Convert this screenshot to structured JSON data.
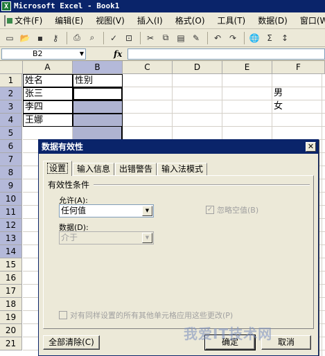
{
  "window": {
    "title": "Microsoft Excel - Book1"
  },
  "menu": [
    "文件(F)",
    "编辑(E)",
    "视图(V)",
    "插入(I)",
    "格式(O)",
    "工具(T)",
    "数据(D)",
    "窗口(W)"
  ],
  "toolbar": {
    "icons": [
      "new-icon",
      "open-icon",
      "save-icon",
      "permission-icon",
      "print-icon",
      "print-preview-icon",
      "spelling-icon",
      "research-icon",
      "cut-icon",
      "copy-icon",
      "paste-icon",
      "format-painter-icon",
      "undo-icon",
      "redo-icon",
      "hyperlink-icon",
      "autosum-icon",
      "sort-ascending-icon"
    ],
    "sigma": "Σ"
  },
  "formula_bar": {
    "name_box": "B2",
    "fx": "fx",
    "formula": ""
  },
  "sheet": {
    "columns": [
      "A",
      "B",
      "C",
      "D",
      "E",
      "F"
    ],
    "rows": [
      "1",
      "2",
      "3",
      "4",
      "5",
      "6",
      "7",
      "8",
      "9",
      "10",
      "11",
      "12",
      "13",
      "14",
      "15",
      "16",
      "17",
      "18",
      "19",
      "20",
      "21"
    ],
    "cells": {
      "A1": "姓名",
      "B1": "性别",
      "A2": "张三",
      "A3": "李四",
      "A4": "王娜",
      "F2": "男",
      "F3": "女"
    },
    "active_cell": "B2",
    "selected_range": "B2:B5"
  },
  "dialog": {
    "title": "数据有效性",
    "close": "✕",
    "tabs": [
      "设置",
      "输入信息",
      "出错警告",
      "输入法模式"
    ],
    "active_tab": "设置",
    "group_label": "有效性条件",
    "allow_label": "允许(A):",
    "allow_value": "任何值",
    "ignore_blank_label": "忽略空值(B)",
    "ignore_blank_checked": true,
    "data_label": "数据(D):",
    "data_value": "介于",
    "apply_all_label": "对有同样设置的所有其他单元格应用这些更改(P)",
    "apply_all_checked": false,
    "clear_all": "全部清除(C)",
    "ok": "确定",
    "cancel": "取消"
  },
  "watermark": "我爱IT技术网"
}
